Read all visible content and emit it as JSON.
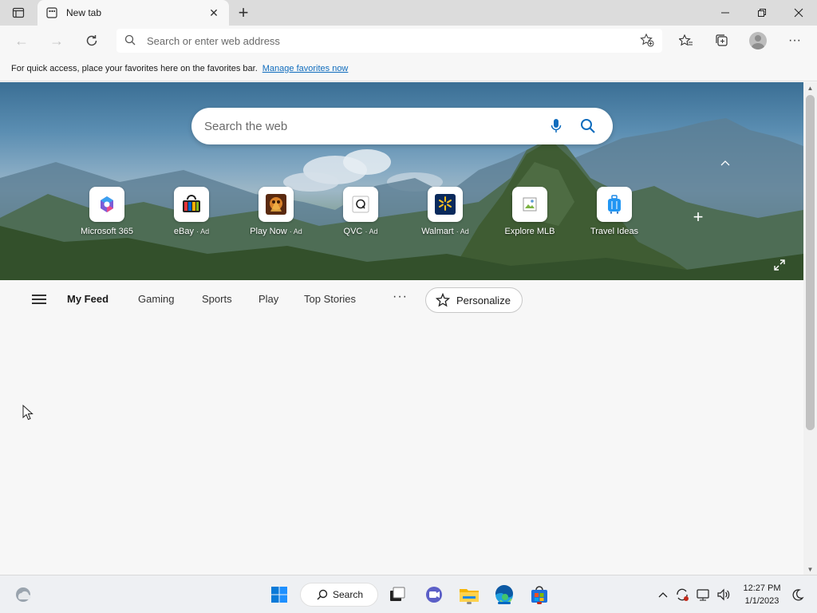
{
  "browser": {
    "tab_title": "New tab",
    "address_placeholder": "Search or enter web address"
  },
  "favorites_bar": {
    "message": "For quick access, place your favorites here on the favorites bar.",
    "link": "Manage favorites now"
  },
  "hero": {
    "search_placeholder": "Search the web",
    "tiles": [
      {
        "label": "Microsoft 365",
        "ad": "",
        "icon": "microsoft-365-icon"
      },
      {
        "label": "eBay",
        "ad": "· Ad",
        "icon": "ebay-icon"
      },
      {
        "label": "Play Now",
        "ad": "· Ad",
        "icon": "play-now-icon"
      },
      {
        "label": "QVC",
        "ad": "· Ad",
        "icon": "qvc-icon"
      },
      {
        "label": "Walmart",
        "ad": "· Ad",
        "icon": "walmart-icon"
      },
      {
        "label": "Explore MLB",
        "ad": "",
        "icon": "broken-image-icon"
      },
      {
        "label": "Travel Ideas",
        "ad": "",
        "icon": "travel-suitcase-icon"
      }
    ]
  },
  "feed": {
    "tabs": [
      "My Feed",
      "Gaming",
      "Sports",
      "Play",
      "Top Stories"
    ],
    "more": "···",
    "personalize": "Personalize"
  },
  "taskbar": {
    "search_label": "Search",
    "time": "12:27 PM",
    "date": "1/1/2023"
  },
  "colors": {
    "accent": "#0067c0",
    "link": "#0f6cbd"
  }
}
